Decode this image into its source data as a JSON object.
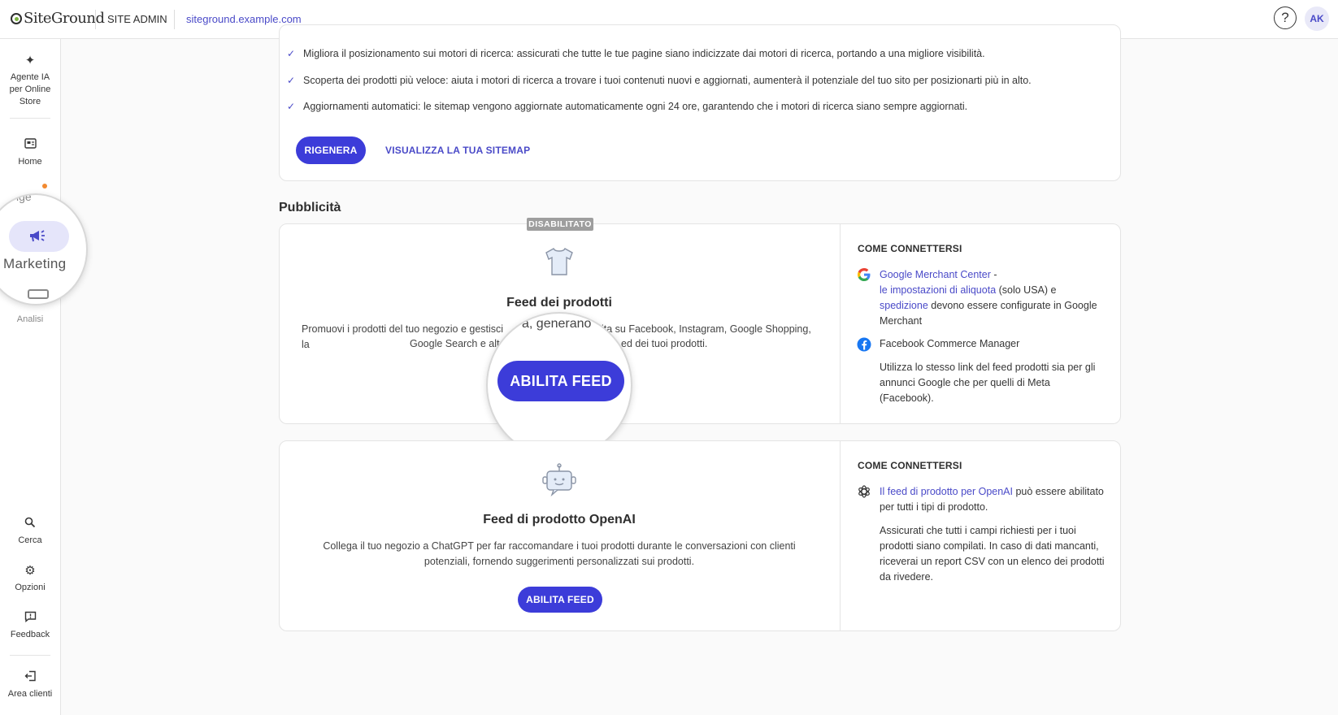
{
  "header": {
    "logo_text": "SiteGround",
    "section": "SITE ADMIN",
    "domain": "siteground.example.com",
    "help_label": "?",
    "avatar_initials": "AK"
  },
  "sidebar": {
    "items": [
      {
        "label": "Agente IA per Online Store",
        "icon": "sparkle-icon"
      },
      {
        "label": "Home",
        "icon": "home-icon"
      },
      {
        "label": "Marketing",
        "icon": "megaphone-icon",
        "active": true
      },
      {
        "label": "Analisi",
        "icon": "analytics-icon"
      },
      {
        "label": "Cerca",
        "icon": "search-icon"
      },
      {
        "label": "Opzioni",
        "icon": "gear-icon"
      },
      {
        "label": "Feedback",
        "icon": "feedback-icon"
      },
      {
        "label": "Area clienti",
        "icon": "exit-icon"
      }
    ],
    "magnified_top_fragment": "lge",
    "magnified_label": "Marketing"
  },
  "sitemap": {
    "bullets": [
      "Migliora il posizionamento sui motori di ricerca: assicurati che tutte le tue pagine siano indicizzate dai motori di ricerca, portando a una migliore visibilità.",
      "Scoperta dei prodotti più veloce: aiuta i motori di ricerca a trovare i tuoi contenuti nuovi e aggiornati, aumenterà il potenziale del tuo sito per posizionarti più in alto.",
      "Aggiornamenti automatici: le sitemap vengono aggiornate automaticamente ogni 24 ore, garantendo che i motori di ricerca siano sempre aggiornati."
    ],
    "regenerate_label": "RIGENERA",
    "view_label": "VISUALIZZA LA TUA SITEMAP"
  },
  "advertising": {
    "title": "Pubblicità",
    "product_feed": {
      "badge": "DISABILITATO",
      "icon": "tshirt-icon",
      "title": "Feed dei prodotti",
      "desc_line1": "Promuovi i prodotti del tuo negozio e gestisci la",
      "desc_line1_end": "ita su Facebook, Instagram, Google Shopping,",
      "desc_line2_start": "Google Search e alt",
      "desc_line2_end": "ed dei tuoi prodotti.",
      "button": "ABILITA FEED",
      "magnified_text": "a, generano",
      "magnified_button": "ABILITA FEED",
      "connect_title": "COME CONNETTERSI",
      "google_link": "Google Merchant Center",
      "google_dash": " -",
      "rates_link": "le impostazioni di aliquota",
      "rates_suffix": " (solo USA) e",
      "shipping_link": "spedizione",
      "shipping_suffix": " devono essere configurate in Google Merchant",
      "facebook_link": "Facebook Commerce Manager",
      "facebook_note": "Utilizza lo stesso link del feed prodotti sia per gli annunci Google che per quelli di Meta (Facebook)."
    },
    "openai_feed": {
      "icon": "robot-icon",
      "title": "Feed di prodotto OpenAI",
      "desc": "Collega il tuo negozio a ChatGPT per far raccomandare i tuoi prodotti durante le conversazioni con clienti potenziali, fornendo suggerimenti personalizzati sui prodotti.",
      "button": "ABILITA FEED",
      "connect_title": "COME CONNETTERSI",
      "openai_link": "Il feed di prodotto per OpenAI",
      "openai_suffix": " può essere abilitato per tutti i tipi di prodotto.",
      "note": "Assicurati che tutti i campi richiesti per i tuoi prodotti siano compilati. In caso di dati mancanti, riceverai un report CSV con un elenco dei prodotti da rivedere."
    }
  },
  "colors": {
    "accent": "#3c3cd9",
    "link": "#4a4ac8",
    "badge": "#9e9e9e"
  }
}
